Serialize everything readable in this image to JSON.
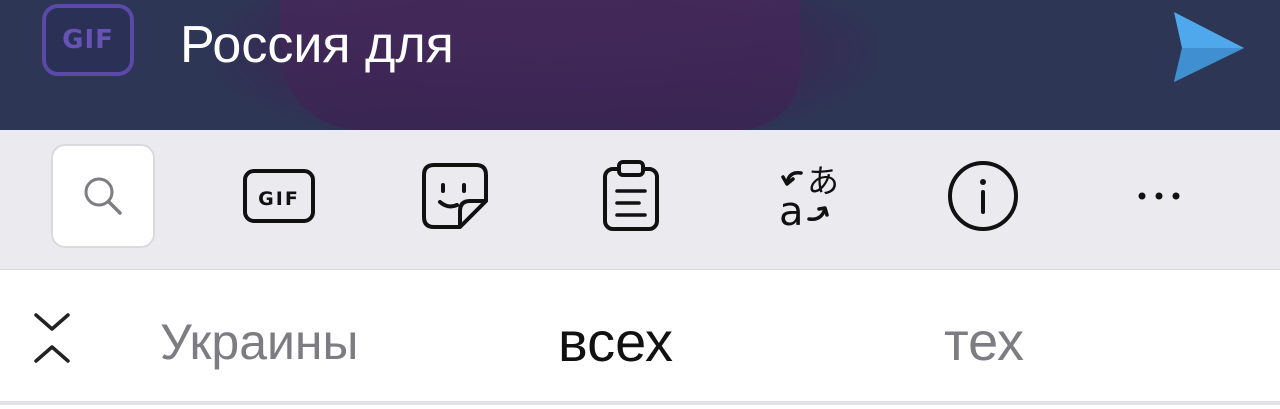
{
  "compose": {
    "gif_button_label": "GIF",
    "text": "Россия для",
    "send_icon": "send-icon",
    "colors": {
      "background": "#2d3655",
      "send": "#4fa8ec",
      "gif": "#5b49a8"
    }
  },
  "toolbar": {
    "items": [
      {
        "name": "search",
        "icon": "search-icon"
      },
      {
        "name": "gif",
        "icon": "gif-icon",
        "label": "GIF"
      },
      {
        "name": "sticker",
        "icon": "sticker-icon"
      },
      {
        "name": "clipboard",
        "icon": "clipboard-icon"
      },
      {
        "name": "translate",
        "icon": "translate-icon"
      },
      {
        "name": "info",
        "icon": "info-icon"
      },
      {
        "name": "more",
        "icon": "more-icon"
      }
    ]
  },
  "suggestions": {
    "collapse_icon": "collapse-icon",
    "words": [
      "Украины",
      "всех",
      "тех"
    ]
  }
}
